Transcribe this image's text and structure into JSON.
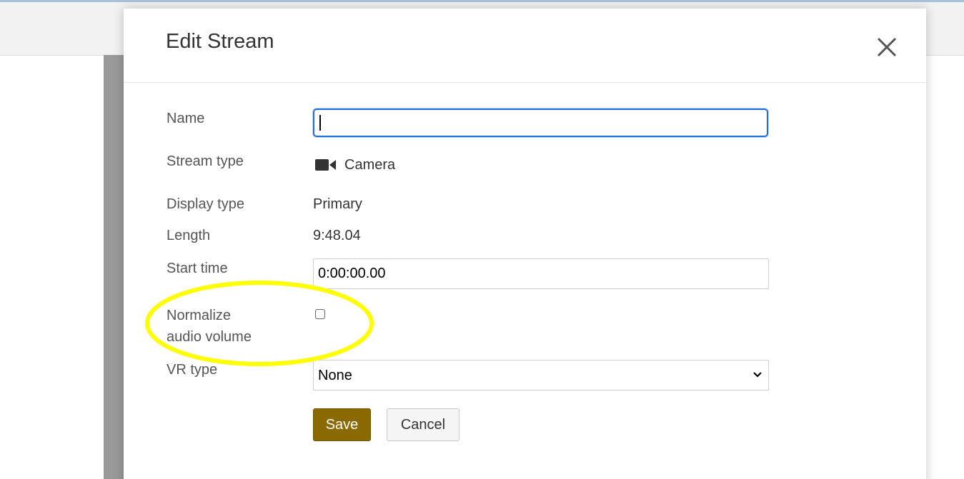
{
  "dialog": {
    "title": "Edit Stream",
    "close_icon": "close-icon"
  },
  "form": {
    "name": {
      "label": "Name",
      "value": ""
    },
    "stream_type": {
      "label": "Stream type",
      "icon": "video-camera-icon",
      "value": "Camera"
    },
    "display_type": {
      "label": "Display type",
      "value": "Primary"
    },
    "length": {
      "label": "Length",
      "value": "9:48.04"
    },
    "start_time": {
      "label": "Start time",
      "value": "0:00:00.00"
    },
    "normalize_audio": {
      "label_line1": "Normalize",
      "label_line2": "audio volume",
      "checked": false
    },
    "vr_type": {
      "label": "VR type",
      "selected": "None"
    }
  },
  "buttons": {
    "save_label": "Save",
    "cancel_label": "Cancel"
  },
  "colors": {
    "save_button": "#8a6a00",
    "focus_border": "#1f6fd6",
    "highlight_annotation": "#ffff00"
  }
}
